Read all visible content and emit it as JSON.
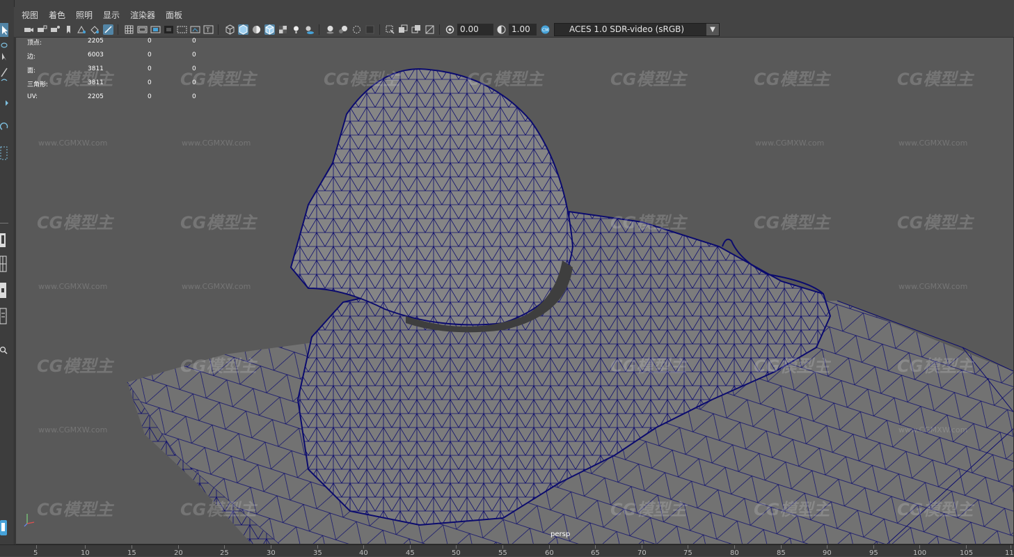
{
  "menubar": {
    "items": [
      "视图",
      "着色",
      "照明",
      "显示",
      "渲染器",
      "面板"
    ]
  },
  "toolbar": {
    "exposure_value": "0.00",
    "gamma_value": "1.00",
    "colorspace": "ACES 1.0 SDR-video (sRGB)"
  },
  "hud": {
    "rows": [
      {
        "label": "顶点:",
        "v1": "2205",
        "v2": "0",
        "v3": "0"
      },
      {
        "label": "边:",
        "v1": "6003",
        "v2": "0",
        "v3": "0"
      },
      {
        "label": "面:",
        "v1": "3811",
        "v2": "0",
        "v3": "0"
      },
      {
        "label": "三角形:",
        "v1": "3811",
        "v2": "0",
        "v3": "0"
      },
      {
        "label": "UV:",
        "v1": "2205",
        "v2": "0",
        "v3": "0"
      }
    ]
  },
  "viewport": {
    "camera": "persp",
    "watermark_logo": "CG模型主",
    "watermark_url": "www.CGMXW.com"
  },
  "timeline": {
    "ticks": [
      "5",
      "10",
      "15",
      "20",
      "25",
      "30",
      "35",
      "40",
      "45",
      "50",
      "55",
      "60",
      "65",
      "70",
      "75",
      "80",
      "85",
      "90",
      "95",
      "100",
      "105",
      "11"
    ]
  },
  "colors": {
    "background": "#444444",
    "viewport": "#5a5a5a",
    "wire": "#0a0a6a",
    "accent": "#5285a6"
  }
}
